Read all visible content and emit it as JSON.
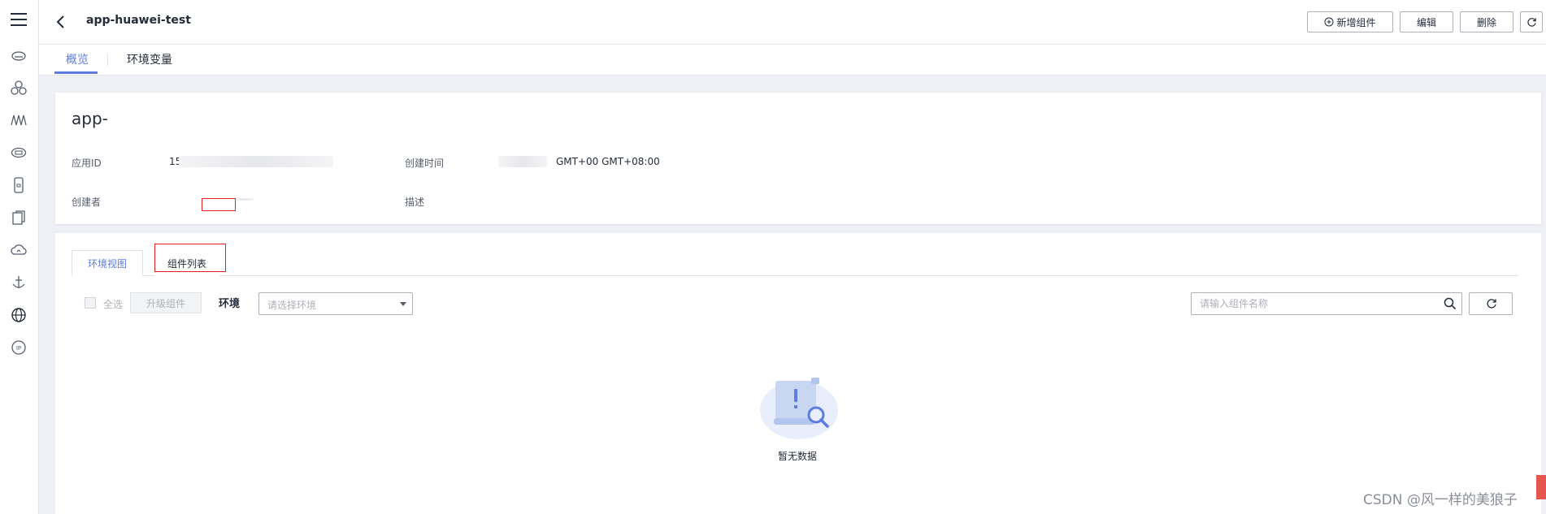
{
  "header": {
    "app_title": "app-huawei-test",
    "add_component_label": "新增组件",
    "edit_label": "编辑",
    "delete_label": "删除"
  },
  "page_tabs": [
    {
      "label": "概览",
      "active": true
    },
    {
      "label": "环境变量",
      "active": false
    }
  ],
  "overview": {
    "app_name": "app-",
    "app_id_label": "应用ID",
    "app_id_value": "15",
    "created_time_label": "创建时间",
    "created_time_value": "GMT+00 GMT+08:00",
    "creator_label": "创建者",
    "description_label": "描述"
  },
  "sub_tabs": [
    {
      "label": "环境视图",
      "active": true
    },
    {
      "label": "组件列表",
      "active": false
    }
  ],
  "toolbar": {
    "select_all_label": "全选",
    "upgrade_label": "升级组件",
    "env_label": "环境",
    "env_placeholder": "请选择环境",
    "search_placeholder": "请输入组件名称"
  },
  "empty": {
    "text": "暂无数据"
  },
  "watermark": "CSDN @风一样的美狼子",
  "colors": {
    "accent": "#5e7ce0",
    "highlight_box": "#e02020",
    "page_background": "#eef0f5"
  },
  "left_nav_icons": [
    "menu-icon",
    "cloud-icon",
    "cluster-icon",
    "wave-icon",
    "cloud-server-icon",
    "device-icon",
    "document-icon",
    "cloud-sync-icon",
    "anchor-icon",
    "globe-icon",
    "ip-icon"
  ]
}
